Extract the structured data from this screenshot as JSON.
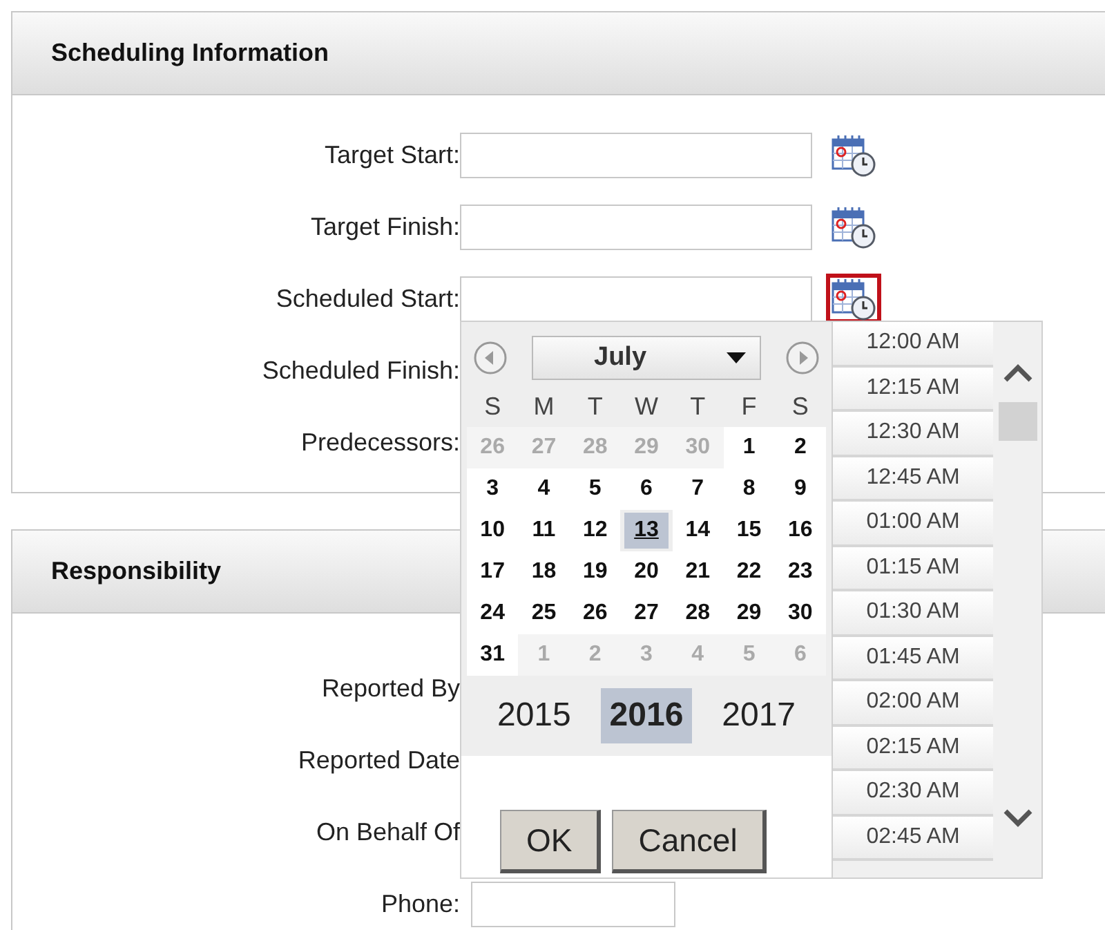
{
  "sections": [
    {
      "title": "Scheduling Information",
      "fields": [
        {
          "label": "Target Start:",
          "kind": "date",
          "active": false
        },
        {
          "label": "Target Finish:",
          "kind": "date",
          "active": false
        },
        {
          "label": "Scheduled Start:",
          "kind": "date",
          "active": true
        },
        {
          "label": "Scheduled Finish:",
          "kind": "label"
        },
        {
          "label": "Predecessors:",
          "kind": "label"
        }
      ]
    },
    {
      "title": "Responsibility",
      "fields": [
        {
          "label": "Reported By",
          "kind": "label"
        },
        {
          "label": "Reported Date",
          "kind": "label"
        },
        {
          "label": "On Behalf Of",
          "kind": "label"
        },
        {
          "label": "Phone:",
          "kind": "text"
        }
      ]
    }
  ],
  "picker": {
    "month": "July",
    "weekdays": [
      "S",
      "M",
      "T",
      "W",
      "T",
      "F",
      "S"
    ],
    "weeks": [
      [
        {
          "day": "26",
          "kind": "other",
          "selected": false
        },
        {
          "day": "27",
          "kind": "other",
          "selected": false
        },
        {
          "day": "28",
          "kind": "other",
          "selected": false
        },
        {
          "day": "29",
          "kind": "other",
          "selected": false
        },
        {
          "day": "30",
          "kind": "other",
          "selected": false
        },
        {
          "day": "1",
          "kind": "current",
          "selected": false
        },
        {
          "day": "2",
          "kind": "current",
          "selected": false
        }
      ],
      [
        {
          "day": "3",
          "kind": "current",
          "selected": false
        },
        {
          "day": "4",
          "kind": "current",
          "selected": false
        },
        {
          "day": "5",
          "kind": "current",
          "selected": false
        },
        {
          "day": "6",
          "kind": "current",
          "selected": false
        },
        {
          "day": "7",
          "kind": "current",
          "selected": false
        },
        {
          "day": "8",
          "kind": "current",
          "selected": false
        },
        {
          "day": "9",
          "kind": "current",
          "selected": false
        }
      ],
      [
        {
          "day": "10",
          "kind": "current",
          "selected": false
        },
        {
          "day": "11",
          "kind": "current",
          "selected": false
        },
        {
          "day": "12",
          "kind": "current",
          "selected": false
        },
        {
          "day": "13",
          "kind": "current",
          "selected": true
        },
        {
          "day": "14",
          "kind": "current",
          "selected": false
        },
        {
          "day": "15",
          "kind": "current",
          "selected": false
        },
        {
          "day": "16",
          "kind": "current",
          "selected": false
        }
      ],
      [
        {
          "day": "17",
          "kind": "current",
          "selected": false
        },
        {
          "day": "18",
          "kind": "current",
          "selected": false
        },
        {
          "day": "19",
          "kind": "current",
          "selected": false
        },
        {
          "day": "20",
          "kind": "current",
          "selected": false
        },
        {
          "day": "21",
          "kind": "current",
          "selected": false
        },
        {
          "day": "22",
          "kind": "current",
          "selected": false
        },
        {
          "day": "23",
          "kind": "current",
          "selected": false
        }
      ],
      [
        {
          "day": "24",
          "kind": "current",
          "selected": false
        },
        {
          "day": "25",
          "kind": "current",
          "selected": false
        },
        {
          "day": "26",
          "kind": "current",
          "selected": false
        },
        {
          "day": "27",
          "kind": "current",
          "selected": false
        },
        {
          "day": "28",
          "kind": "current",
          "selected": false
        },
        {
          "day": "29",
          "kind": "current",
          "selected": false
        },
        {
          "day": "30",
          "kind": "current",
          "selected": false
        }
      ],
      [
        {
          "day": "31",
          "kind": "current",
          "selected": false
        },
        {
          "day": "1",
          "kind": "other",
          "selected": false
        },
        {
          "day": "2",
          "kind": "other",
          "selected": false
        },
        {
          "day": "3",
          "kind": "other",
          "selected": false
        },
        {
          "day": "4",
          "kind": "other",
          "selected": false
        },
        {
          "day": "5",
          "kind": "other",
          "selected": false
        },
        {
          "day": "6",
          "kind": "other",
          "selected": false
        }
      ]
    ],
    "years": [
      {
        "label": "2015",
        "selected": false
      },
      {
        "label": "2016",
        "selected": true
      },
      {
        "label": "2017",
        "selected": false
      }
    ],
    "buttons": [
      "OK",
      "Cancel"
    ],
    "times": [
      "12:00 AM",
      "12:15 AM",
      "12:30 AM",
      "12:45 AM",
      "01:00 AM",
      "01:15 AM",
      "01:30 AM",
      "01:45 AM",
      "02:00 AM",
      "02:15 AM",
      "02:30 AM",
      "02:45 AM"
    ]
  }
}
